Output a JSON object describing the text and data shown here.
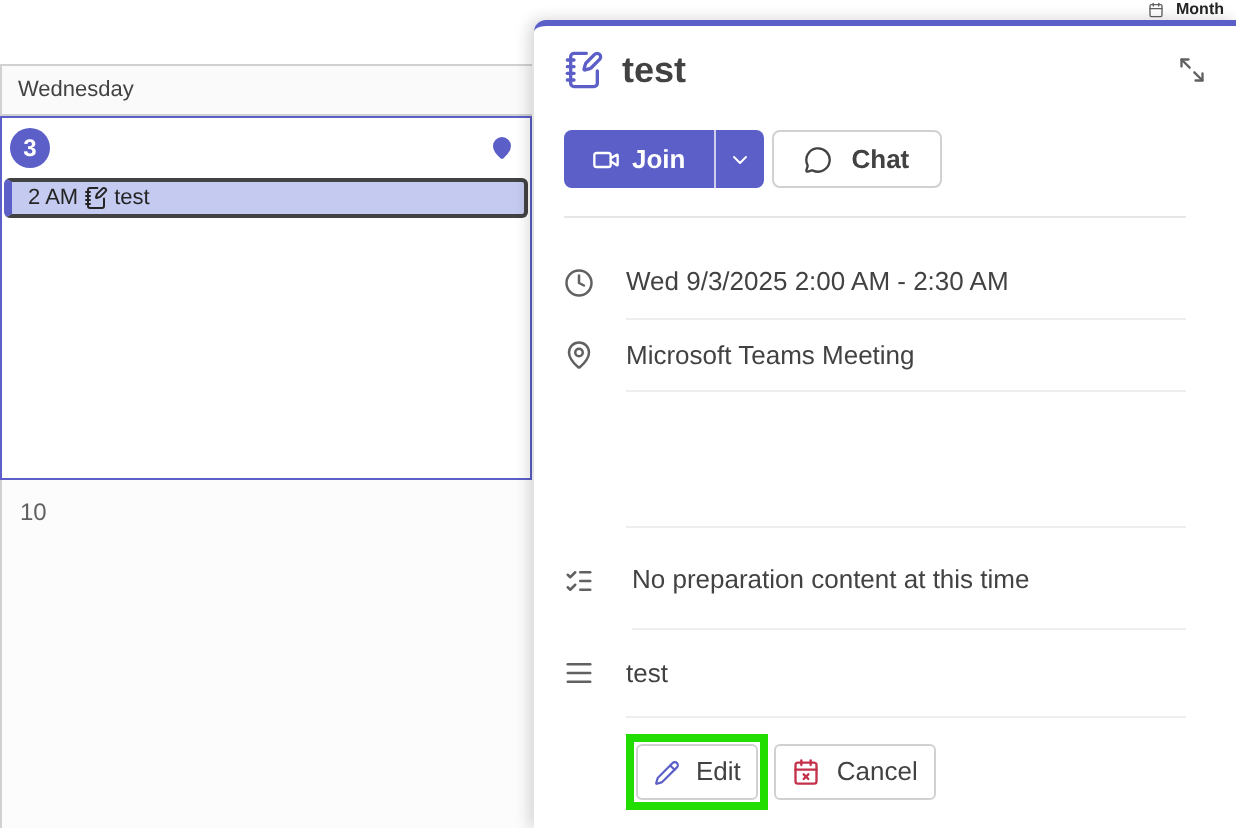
{
  "view_switcher": {
    "label": "Month"
  },
  "calendar": {
    "day_header": "Wednesday",
    "days": [
      {
        "number": "3",
        "selected": true,
        "events": [
          {
            "time": "2 AM",
            "title": "test",
            "selected": true
          }
        ]
      },
      {
        "number": "10",
        "selected": false
      }
    ]
  },
  "event_details": {
    "title": "test",
    "join_button": "Join",
    "chat_button": "Chat",
    "time": "Wed 9/3/2025 2:00 AM - 2:30 AM",
    "location": "Microsoft Teams Meeting",
    "preparation": "No preparation content at this time",
    "description": "test",
    "actions": [
      {
        "kind": "edit",
        "label": "Edit",
        "highlighted": true
      },
      {
        "kind": "cancel",
        "label": "Cancel",
        "highlighted": false
      }
    ]
  }
}
